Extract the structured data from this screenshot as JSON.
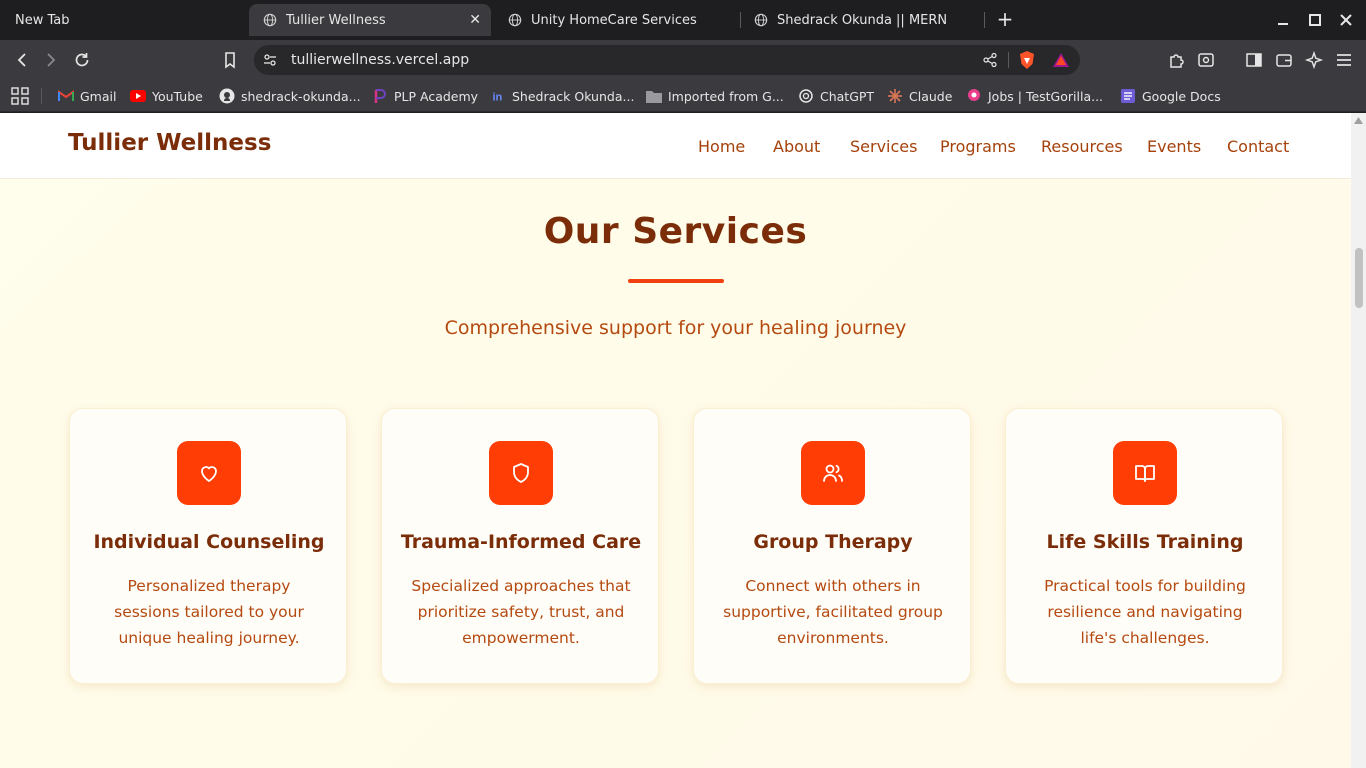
{
  "browser": {
    "tabs": [
      {
        "title": "New Tab",
        "active": false
      },
      {
        "title": "Tullier Wellness",
        "active": true
      },
      {
        "title": "Unity HomeCare Services",
        "active": false
      },
      {
        "title": "Shedrack Okunda || MERN",
        "active": false
      }
    ],
    "url": "tullierwellness.vercel.app",
    "bookmarks": [
      {
        "label": "Gmail",
        "icon": "gmail-icon"
      },
      {
        "label": "YouTube",
        "icon": "youtube-icon"
      },
      {
        "label": "shedrack-okunda...",
        "icon": "github-icon"
      },
      {
        "label": "PLP Academy",
        "icon": "plp-icon"
      },
      {
        "label": "Shedrack Okunda...",
        "icon": "linkedin-icon"
      },
      {
        "label": "Imported from G...",
        "icon": "folder-icon"
      },
      {
        "label": "ChatGPT",
        "icon": "chatgpt-icon"
      },
      {
        "label": "Claude",
        "icon": "claude-icon"
      },
      {
        "label": "Jobs | TestGorilla...",
        "icon": "testgorilla-icon"
      },
      {
        "label": "Google Docs",
        "icon": "google-docs-icon"
      }
    ]
  },
  "site": {
    "logo": "Tullier Wellness",
    "nav": [
      "Home",
      "About",
      "Services",
      "Programs",
      "Resources",
      "Events",
      "Contact"
    ]
  },
  "services": {
    "title": "Our Services",
    "subtitle": "Comprehensive support for your healing journey",
    "cards": [
      {
        "icon": "heart-icon",
        "title": "Individual Counseling",
        "description": "Personalized therapy sessions tailored to your unique healing journey."
      },
      {
        "icon": "shield-icon",
        "title": "Trauma-Informed Care",
        "description": "Specialized approaches that prioritize safety, trust, and empowerment."
      },
      {
        "icon": "users-icon",
        "title": "Group Therapy",
        "description": "Connect with others in supportive, facilitated group environments."
      },
      {
        "icon": "book-open-icon",
        "title": "Life Skills Training",
        "description": "Practical tools for building resilience and navigating life's challenges."
      }
    ]
  },
  "colors": {
    "accent": "#ff3d05",
    "heading": "#7a2d08",
    "body_text": "#b54a10",
    "background": "#fffdeb"
  }
}
